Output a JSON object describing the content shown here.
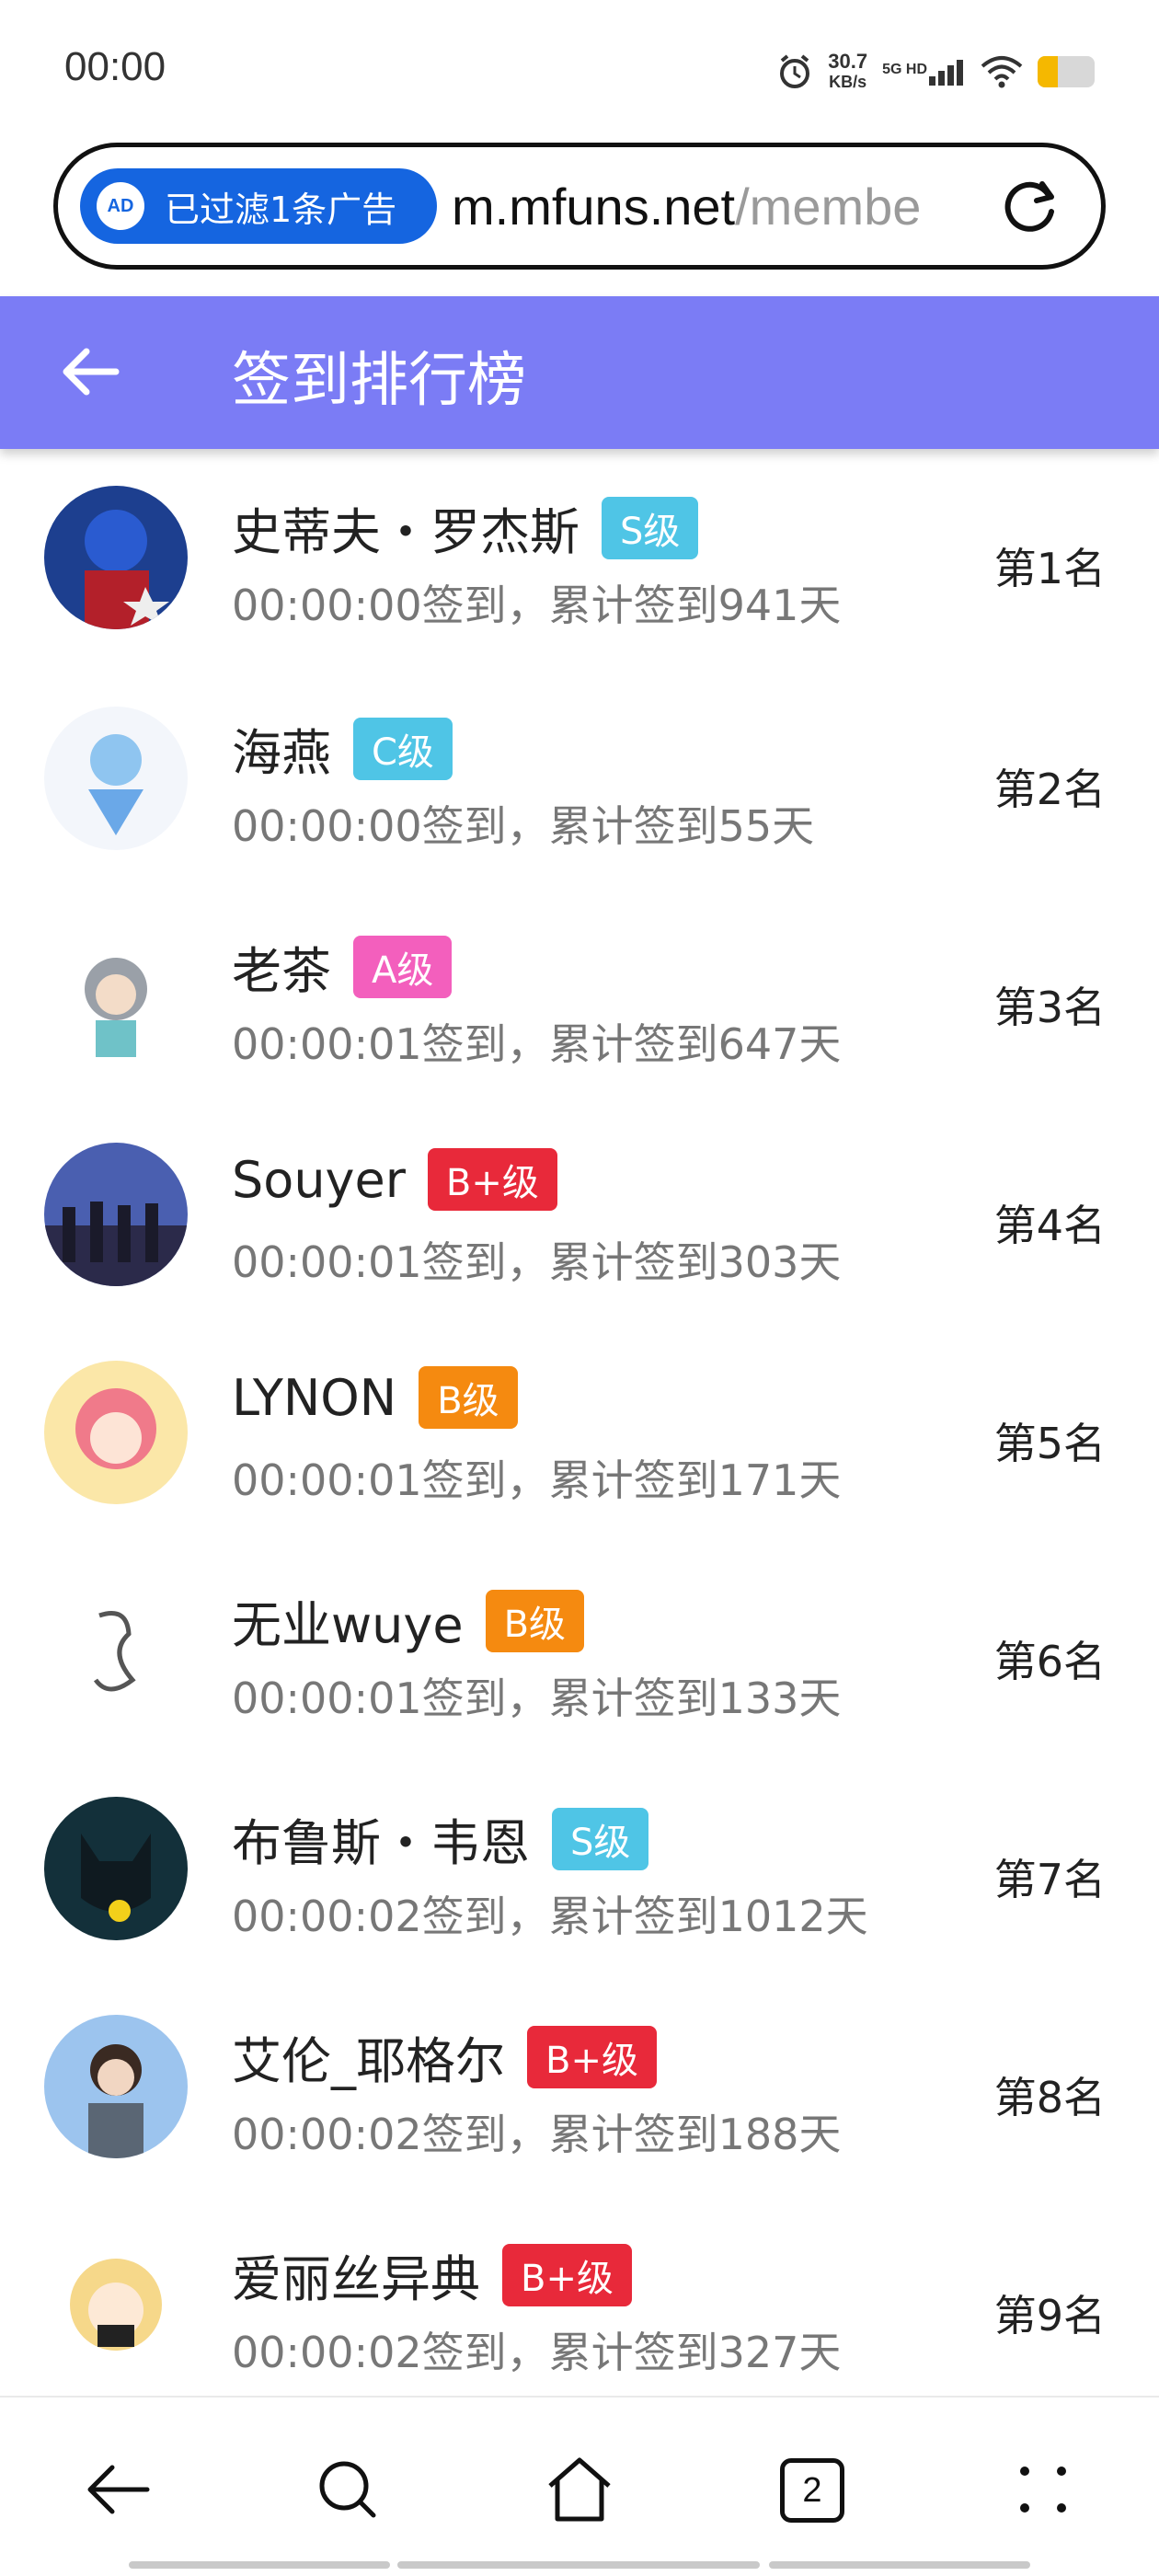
{
  "status_bar": {
    "time": "00:00",
    "net_speed_value": "30.7",
    "net_speed_unit": "KB/s",
    "signal_label": "5G HD",
    "battery_level": 0.35,
    "battery_color": "#f5b800"
  },
  "url_bar": {
    "ad_filter_text": "已过滤1条广告",
    "url_domain": "m.mfuns.net",
    "url_path": "/membe",
    "reload_icon": "reload-icon"
  },
  "header": {
    "title": "签到排行榜",
    "background_color": "#7b7cf5",
    "back_icon": "back-arrow-icon"
  },
  "rows": [
    {
      "name": "史蒂夫・罗杰斯",
      "badge": "S级",
      "badge_color": "#4fc5e6",
      "detail": "00:00:00签到，累计签到941天",
      "rank": "第1名",
      "avatar": "captain-america-avatar"
    },
    {
      "name": "海燕",
      "badge": "C级",
      "badge_color": "#4fc5e6",
      "detail": "00:00:00签到，累计签到55天",
      "rank": "第2名",
      "avatar": "anime-fairy-avatar"
    },
    {
      "name": "老茶",
      "badge": "A级",
      "badge_color": "#f35fbd",
      "detail": "00:00:01签到，累计签到647天",
      "rank": "第3名",
      "avatar": "anime-girl-avatar"
    },
    {
      "name": "Souyer",
      "badge": "B+级",
      "badge_color": "#e8293a",
      "detail": "00:00:01签到，累计签到303天",
      "rank": "第4名",
      "avatar": "group-silhouette-avatar"
    },
    {
      "name": "LYNON",
      "badge": "B级",
      "badge_color": "#f58a10",
      "detail": "00:00:01签到，累计签到171天",
      "rank": "第5名",
      "avatar": "pink-hair-anime-avatar"
    },
    {
      "name": "无业wuye",
      "badge": "B级",
      "badge_color": "#f58a10",
      "detail": "00:00:01签到，累计签到133天",
      "rank": "第6名",
      "avatar": "sketch-figure-avatar"
    },
    {
      "name": "布鲁斯・韦恩",
      "badge": "S级",
      "badge_color": "#4fc5e6",
      "detail": "00:00:02签到，累计签到1012天",
      "rank": "第7名",
      "avatar": "batman-avatar"
    },
    {
      "name": "艾伦_耶格尔",
      "badge": "B+级",
      "badge_color": "#e8293a",
      "detail": "00:00:02签到，累计签到188天",
      "rank": "第8名",
      "avatar": "eren-anime-avatar"
    },
    {
      "name": "爱丽丝异典",
      "badge": "B+级",
      "badge_color": "#e8293a",
      "detail": "00:00:02签到，累计签到327天",
      "rank": "第9名",
      "avatar": "blonde-chibi-avatar"
    }
  ],
  "bottom_nav": {
    "back_icon": "back-icon",
    "search_icon": "search-icon",
    "home_icon": "home-icon",
    "tabs_count": "2",
    "menu_icon": "menu-dots-icon"
  }
}
